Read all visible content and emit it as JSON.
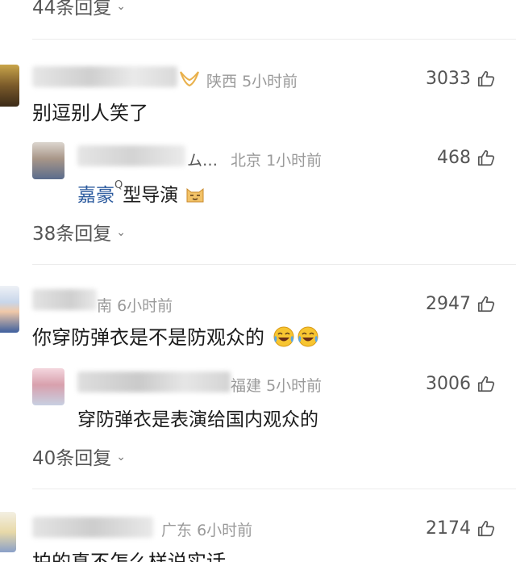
{
  "top_replies": {
    "label": "44条回复"
  },
  "comments": [
    {
      "location": "陕西",
      "time": "5小时前",
      "likes": "3033",
      "text": "别逗别人笑了",
      "reply": {
        "name_tail": "ム…",
        "location": "北京",
        "time": "1小时前",
        "likes": "468",
        "text_part1": "嘉豪",
        "tag": "Q",
        "text_part2": "型导演"
      },
      "replies_label": "38条回复"
    },
    {
      "location_partial": "南",
      "time": "6小时前",
      "likes": "2947",
      "text": "你穿防弹衣是不是防观众的",
      "reply": {
        "location_partial": "福建",
        "time": "5小时前",
        "likes": "3006",
        "text": "穿防弹衣是表演给国内观众的"
      },
      "replies_label": "40条回复"
    },
    {
      "location": "广东",
      "time": "6小时前",
      "likes": "2174",
      "text": "拍的真不怎么样说实话…"
    }
  ],
  "colors": {
    "badge": "#e9b04a",
    "meta": "#9a9a9a",
    "divider": "#ececec"
  },
  "icons": [
    "thumb-up-icon",
    "chevron-down-icon",
    "vip-badge-icon",
    "laugh-cry-emoji",
    "cat-face-emoji"
  ]
}
